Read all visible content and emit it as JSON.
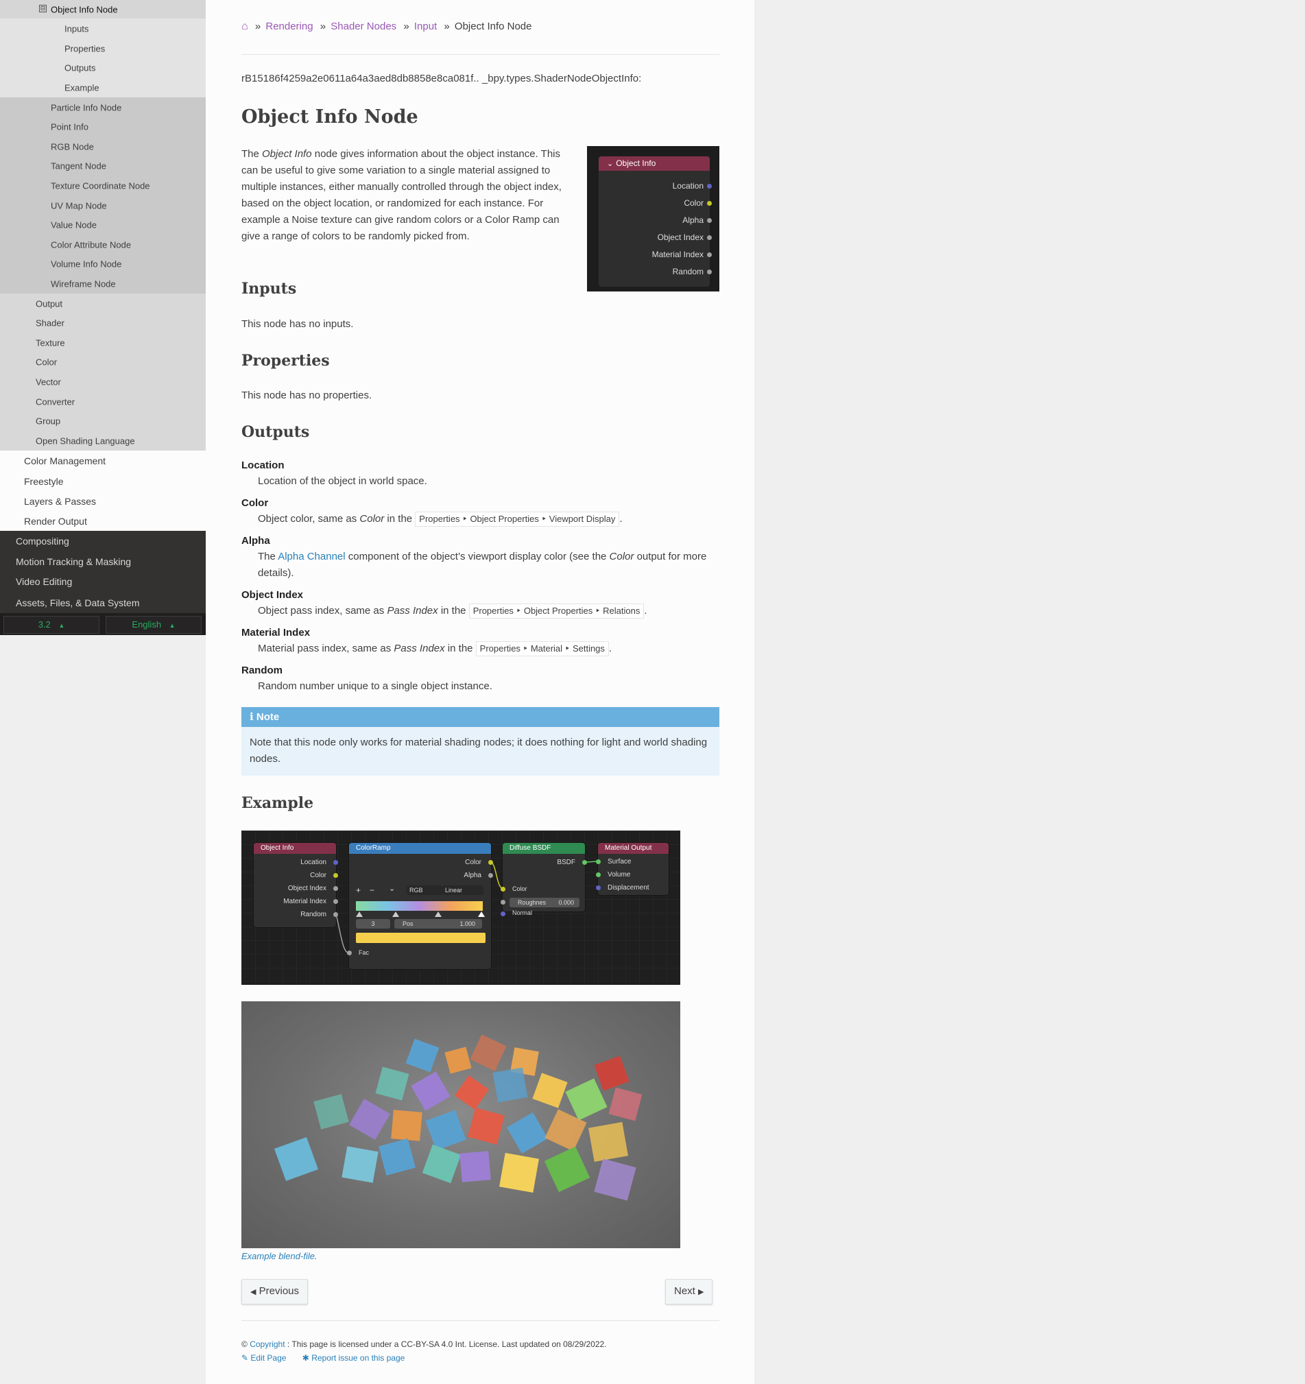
{
  "sidebar": {
    "items": [
      {
        "label": "Object Info Node",
        "level": 3,
        "current": true
      },
      {
        "label": "Inputs",
        "level": 4
      },
      {
        "label": "Properties",
        "level": 4
      },
      {
        "label": "Outputs",
        "level": 4
      },
      {
        "label": "Example",
        "level": 4
      },
      {
        "label": "Particle Info Node",
        "level": 3
      },
      {
        "label": "Point Info",
        "level": 3
      },
      {
        "label": "RGB Node",
        "level": 3
      },
      {
        "label": "Tangent Node",
        "level": 3
      },
      {
        "label": "Texture Coordinate Node",
        "level": 3
      },
      {
        "label": "UV Map Node",
        "level": 3
      },
      {
        "label": "Value Node",
        "level": 3
      },
      {
        "label": "Color Attribute Node",
        "level": 3
      },
      {
        "label": "Volume Info Node",
        "level": 3
      },
      {
        "label": "Wireframe Node",
        "level": 3
      },
      {
        "label": "Output",
        "level": 2
      },
      {
        "label": "Shader",
        "level": 2
      },
      {
        "label": "Texture",
        "level": 2
      },
      {
        "label": "Color",
        "level": 2
      },
      {
        "label": "Vector",
        "level": 2
      },
      {
        "label": "Converter",
        "level": 2
      },
      {
        "label": "Group",
        "level": 2
      },
      {
        "label": "Open Shading Language",
        "level": 2
      },
      {
        "label": "Color Management",
        "level": 1
      },
      {
        "label": "Freestyle",
        "level": 1
      },
      {
        "label": "Layers & Passes",
        "level": 1
      },
      {
        "label": "Render Output",
        "level": 1
      },
      {
        "label": "Compositing",
        "level": 0
      },
      {
        "label": "Motion Tracking & Masking",
        "level": 0
      },
      {
        "label": "Video Editing",
        "level": 0
      },
      {
        "label": "Assets, Files, & Data System",
        "level": 0
      }
    ],
    "toggle_symbol": "⊟",
    "version": "3.2",
    "language": "English",
    "caret": "▲"
  },
  "breadcrumb": {
    "home_icon": "⌂",
    "sep": "»",
    "items": [
      "Rendering",
      "Shader Nodes",
      "Input"
    ],
    "current": "Object Info Node"
  },
  "ref_line": "rB15186f4259a2e0611a64a3aed8db8858e8ca081f.. _bpy.types.ShaderNodeObjectInfo:",
  "title": "Object Info Node",
  "intro": {
    "t1": "The ",
    "em": "Object Info",
    "t2": " node gives information about the object instance. This can be useful to give some variation to a single material assigned to multiple instances, either manually controlled through the object index, based on the object location, or randomized for each instance. For example a Noise texture can give random colors or a Color Ramp can give a range of colors to be randomly picked from."
  },
  "node_panel": {
    "title": "Object Info",
    "outputs": [
      {
        "label": "Location",
        "color": "#6363c7"
      },
      {
        "label": "Color",
        "color": "#c7c729"
      },
      {
        "label": "Alpha",
        "color": "#a1a1a1"
      },
      {
        "label": "Object Index",
        "color": "#a1a1a1"
      },
      {
        "label": "Material Index",
        "color": "#a1a1a1"
      },
      {
        "label": "Random",
        "color": "#a1a1a1"
      }
    ]
  },
  "inputs": {
    "heading": "Inputs",
    "text": "This node has no inputs."
  },
  "properties": {
    "heading": "Properties",
    "text": "This node has no properties."
  },
  "outputs": {
    "heading": "Outputs",
    "location": {
      "term": "Location",
      "desc": "Location of the object in world space."
    },
    "color": {
      "term": "Color",
      "t1": "Object color, same as ",
      "em": "Color",
      "t2": " in the ",
      "menu": "Properties ‣ Object Properties ‣ Viewport Display",
      "t3": "."
    },
    "alpha": {
      "term": "Alpha",
      "t1": "The ",
      "link": "Alpha Channel",
      "t2": " component of the object’s viewport display color (see the ",
      "em": "Color",
      "t3": " output for more details)."
    },
    "object_index": {
      "term": "Object Index",
      "t1": "Object pass index, same as ",
      "em": "Pass Index",
      "t2": " in the ",
      "menu": "Properties ‣ Object Properties ‣ Relations",
      "t3": "."
    },
    "material_index": {
      "term": "Material Index",
      "t1": "Material pass index, same as ",
      "em": "Pass Index",
      "t2": " in the ",
      "menu": "Properties ‣ Material ‣ Settings",
      "t3": "."
    },
    "random": {
      "term": "Random",
      "desc": "Random number unique to a single object instance."
    }
  },
  "note": {
    "icon": "ℹ",
    "title": "Note",
    "text": "Note that this node only works for material shading nodes; it does nothing for light and world shading nodes."
  },
  "example": {
    "heading": "Example",
    "caption": "Example blend-file.",
    "graph": {
      "object_info": {
        "title": "Object Info",
        "outputs": [
          "Location",
          "Color",
          "Object Index",
          "Material Index",
          "Random"
        ]
      },
      "color_ramp": {
        "title": "ColorRamp",
        "outputs": [
          "Color",
          "Alpha"
        ],
        "mode": "RGB",
        "interp": "Linear",
        "index": "3",
        "pos_label": "Pos",
        "pos_value": "1.000",
        "input": "Fac",
        "plus": "+",
        "minus": "−",
        "chevron": "⌄"
      },
      "diffuse": {
        "title": "Diffuse BSDF",
        "output": "BSDF",
        "color": "Color",
        "roughness_label": "Roughnes",
        "roughness_value": "0.000",
        "normal": "Normal"
      },
      "material_output": {
        "title": "Material Output",
        "inputs": [
          "Surface",
          "Volume",
          "Displacement"
        ]
      }
    }
  },
  "nav": {
    "previous": "Previous",
    "next": "Next",
    "prev_icon": "◀",
    "next_icon": "▶"
  },
  "footer": {
    "copyright_symbol": "©",
    "copyright_link": "Copyright",
    "license": " : This page is licensed under a CC-BY-SA 4.0 Int. License. Last updated on 08/29/2022.",
    "edit_icon": "✎",
    "edit": "Edit Page",
    "report_icon": "✱",
    "report": "Report issue on this page"
  }
}
